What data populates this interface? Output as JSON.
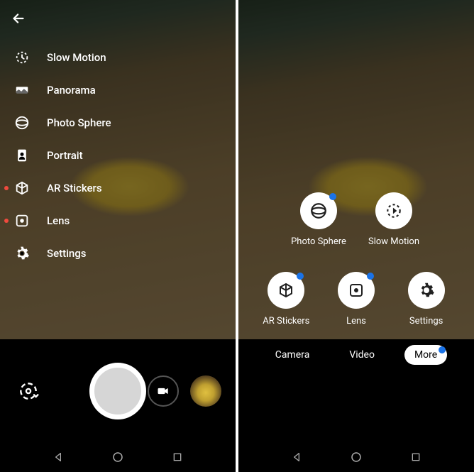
{
  "left": {
    "menu": [
      {
        "label": "Slow Motion",
        "icon": "slow-motion-icon",
        "new": false
      },
      {
        "label": "Panorama",
        "icon": "panorama-icon",
        "new": false
      },
      {
        "label": "Photo Sphere",
        "icon": "photosphere-icon",
        "new": false
      },
      {
        "label": "Portrait",
        "icon": "portrait-icon",
        "new": false
      },
      {
        "label": "AR Stickers",
        "icon": "ar-stickers-icon",
        "new": true
      },
      {
        "label": "Lens",
        "icon": "lens-icon",
        "new": true
      },
      {
        "label": "Settings",
        "icon": "settings-icon",
        "new": false
      }
    ]
  },
  "right": {
    "more_row1": [
      {
        "label": "Photo Sphere",
        "icon": "photosphere-icon",
        "new": true
      },
      {
        "label": "Slow Motion",
        "icon": "slow-motion-icon",
        "new": false
      }
    ],
    "more_row2": [
      {
        "label": "AR Stickers",
        "icon": "ar-stickers-icon",
        "new": true
      },
      {
        "label": "Lens",
        "icon": "lens-icon",
        "new": true
      },
      {
        "label": "Settings",
        "icon": "settings-icon",
        "new": false
      }
    ],
    "modes": {
      "camera": "Camera",
      "video": "Video",
      "more": "More"
    }
  }
}
